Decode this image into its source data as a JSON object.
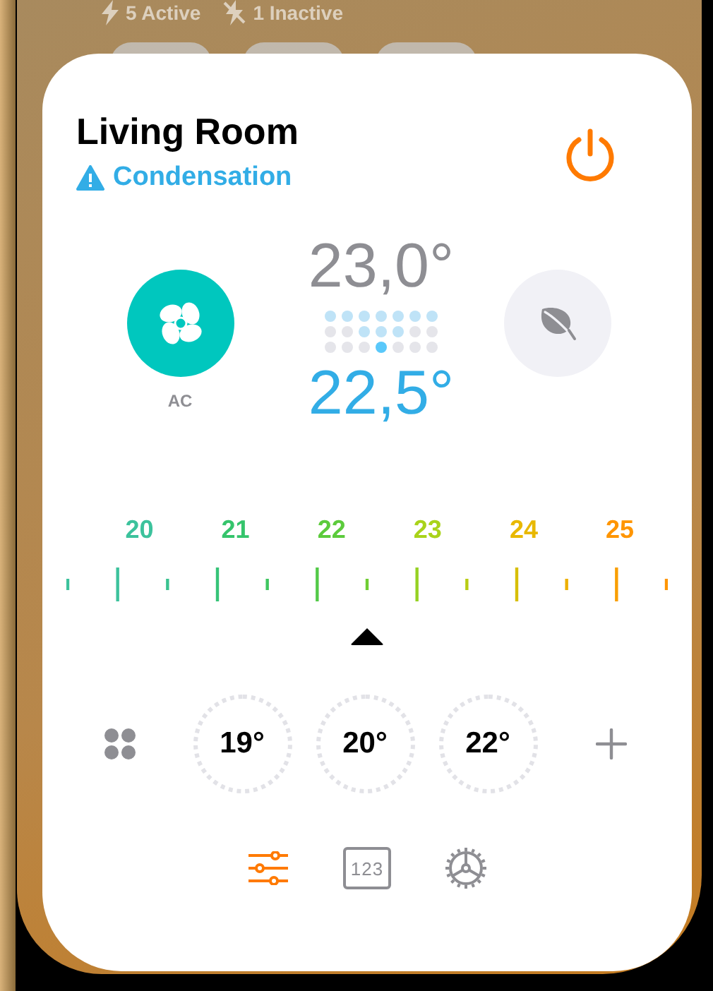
{
  "background": {
    "stats": [
      {
        "kind": "active",
        "label": "5 Active"
      },
      {
        "kind": "inactive",
        "label": "1 Inactive"
      }
    ]
  },
  "room": {
    "name": "Living Room",
    "alert": "Condensation",
    "power_on": true
  },
  "modes": [
    {
      "kind": "ac",
      "label": "AC",
      "selected": true
    },
    {
      "kind": "eco",
      "selected": false
    }
  ],
  "temperatures": {
    "current": "23,0°",
    "target": "22,5°"
  },
  "ruler": {
    "labels": [
      {
        "text": "20",
        "color": "#3cc29c"
      },
      {
        "text": "21",
        "color": "#35c46c"
      },
      {
        "text": "22",
        "color": "#5ccb3c"
      },
      {
        "text": "23",
        "color": "#a9d31a"
      },
      {
        "text": "24",
        "color": "#e8b800"
      },
      {
        "text": "25",
        "color": "#ff9500"
      }
    ],
    "level": 0.5
  },
  "presets": [
    {
      "label": "19°"
    },
    {
      "label": "20°"
    },
    {
      "label": "22°"
    }
  ],
  "tabs": [
    {
      "kind": "controls",
      "selected": true
    },
    {
      "kind": "numbers",
      "label": "123",
      "selected": false
    },
    {
      "kind": "settings",
      "selected": false
    }
  ]
}
